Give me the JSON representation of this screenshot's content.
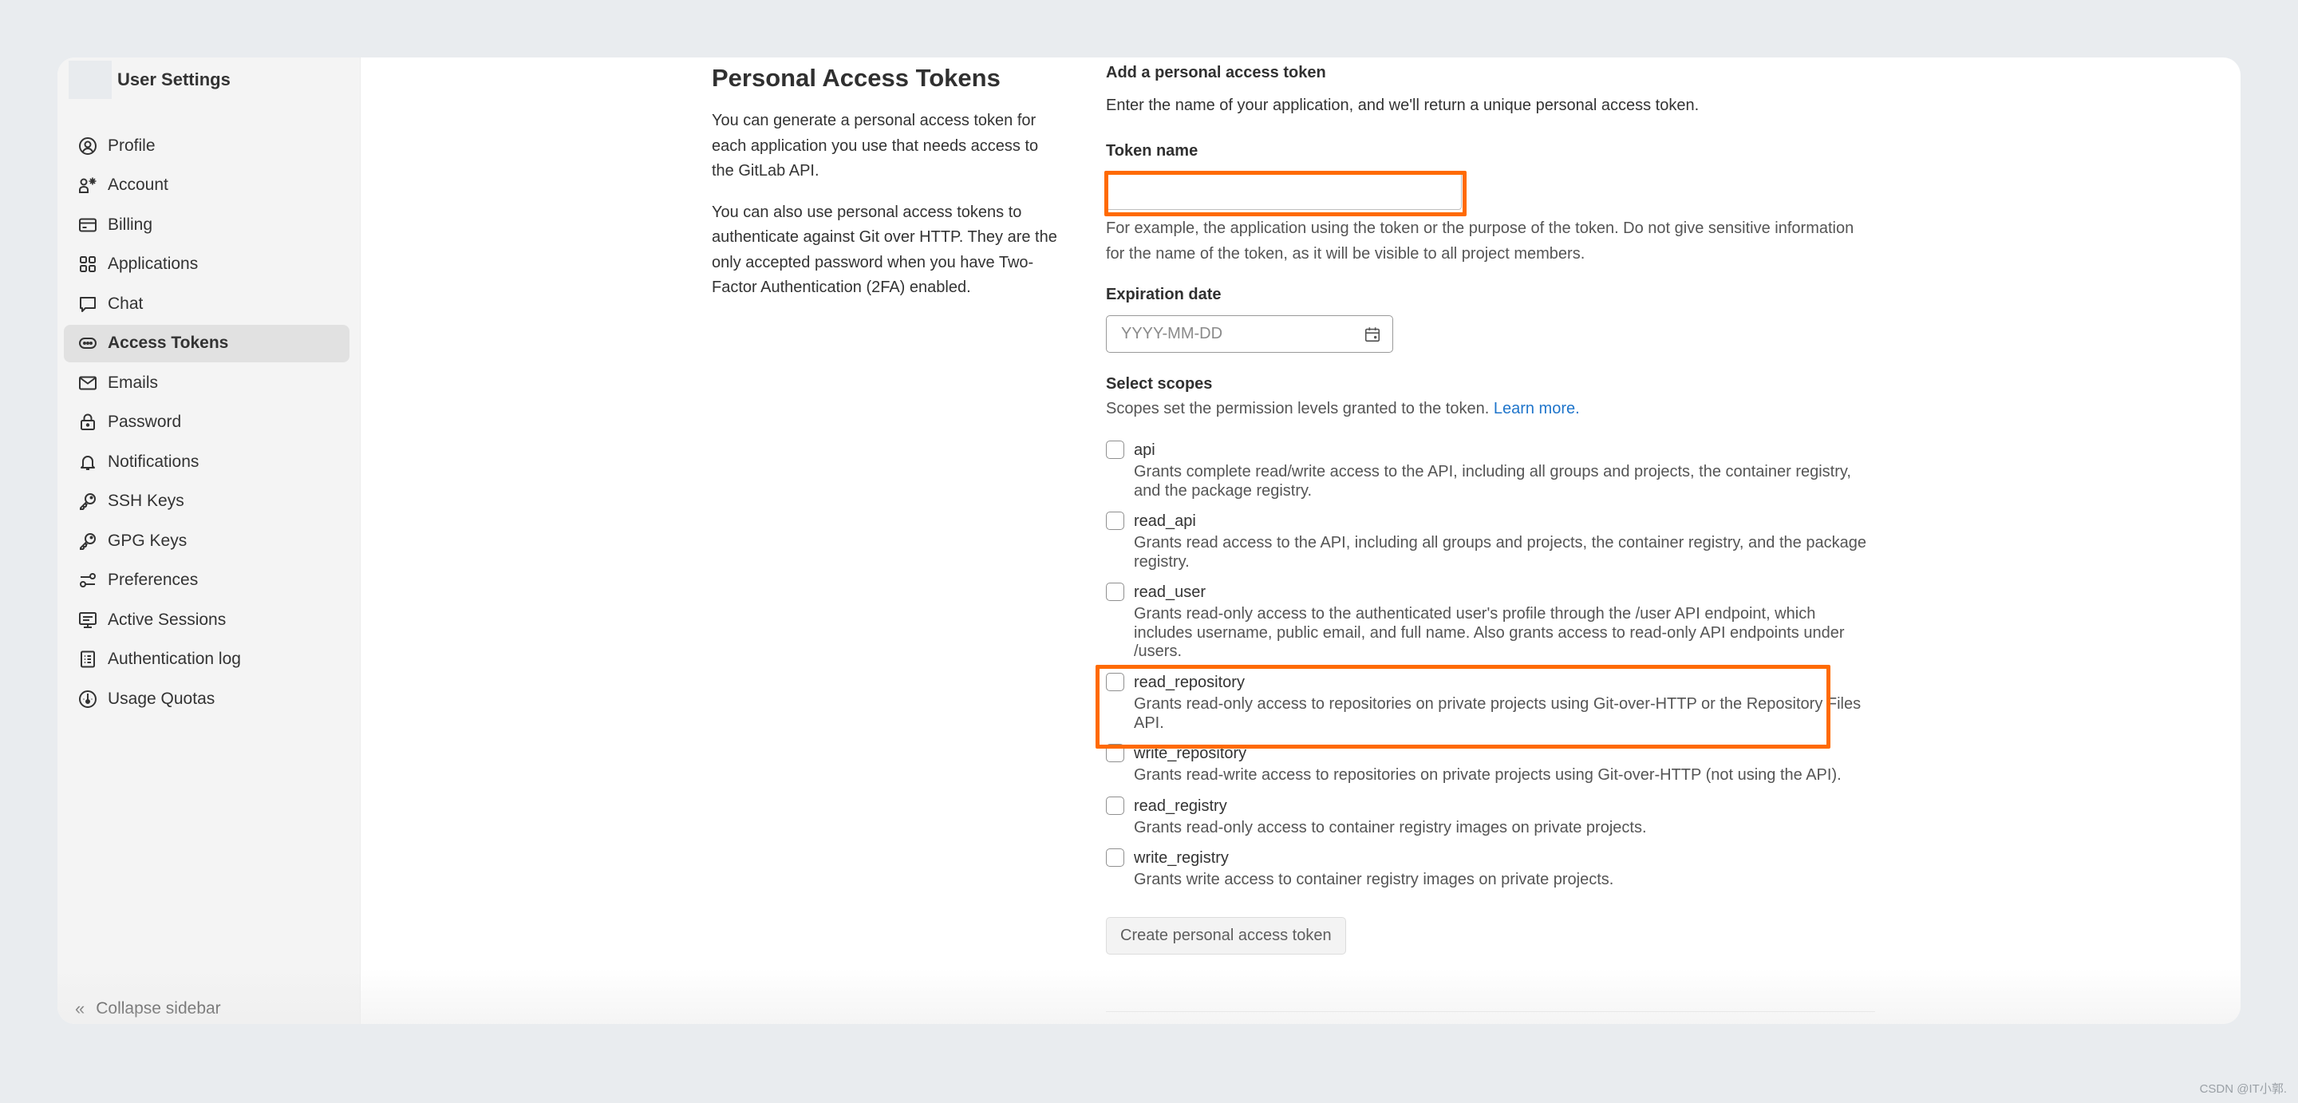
{
  "sidebar": {
    "title": "User Settings",
    "items": [
      {
        "label": "Profile",
        "icon": "profile-icon",
        "active": false
      },
      {
        "label": "Account",
        "icon": "account-icon",
        "active": false
      },
      {
        "label": "Billing",
        "icon": "billing-icon",
        "active": false
      },
      {
        "label": "Applications",
        "icon": "applications-icon",
        "active": false
      },
      {
        "label": "Chat",
        "icon": "chat-icon",
        "active": false
      },
      {
        "label": "Access Tokens",
        "icon": "access-tokens-icon",
        "active": true
      },
      {
        "label": "Emails",
        "icon": "emails-icon",
        "active": false
      },
      {
        "label": "Password",
        "icon": "lock-icon",
        "active": false
      },
      {
        "label": "Notifications",
        "icon": "bell-icon",
        "active": false
      },
      {
        "label": "SSH Keys",
        "icon": "key-icon",
        "active": false
      },
      {
        "label": "GPG Keys",
        "icon": "key-icon",
        "active": false
      },
      {
        "label": "Preferences",
        "icon": "preferences-icon",
        "active": false
      },
      {
        "label": "Active Sessions",
        "icon": "monitor-icon",
        "active": false
      },
      {
        "label": "Authentication log",
        "icon": "log-icon",
        "active": false
      },
      {
        "label": "Usage Quotas",
        "icon": "gauge-icon",
        "active": false
      }
    ],
    "collapse_label": "Collapse sidebar"
  },
  "intro": {
    "title": "Personal Access Tokens",
    "paragraph1": "You can generate a personal access token for each application you use that needs access to the GitLab API.",
    "paragraph2": "You can also use personal access tokens to authenticate against Git over HTTP. They are the only accepted password when you have Two-Factor Authentication (2FA) enabled."
  },
  "form": {
    "title": "Add a personal access token",
    "description": "Enter the name of your application, and we'll return a unique personal access token.",
    "token_name": {
      "label": "Token name",
      "value": "",
      "help": "For example, the application using the token or the purpose of the token. Do not give sensitive information for the name of the token, as it will be visible to all project members."
    },
    "expiration": {
      "label": "Expiration date",
      "placeholder": "YYYY-MM-DD",
      "value": ""
    },
    "scopes": {
      "label": "Select scopes",
      "description": "Scopes set the permission levels granted to the token.",
      "learn_more": "Learn more.",
      "items": [
        {
          "name": "api",
          "checked": false,
          "description": "Grants complete read/write access to the API, including all groups and projects, the container registry, and the package registry."
        },
        {
          "name": "read_api",
          "checked": false,
          "description": "Grants read access to the API, including all groups and projects, the container registry, and the package registry."
        },
        {
          "name": "read_user",
          "checked": false,
          "description": "Grants read-only access to the authenticated user's profile through the /user API endpoint, which includes username, public email, and full name. Also grants access to read-only API endpoints under /users."
        },
        {
          "name": "read_repository",
          "checked": false,
          "description": "Grants read-only access to repositories on private projects using Git-over-HTTP or the Repository Files API."
        },
        {
          "name": "write_repository",
          "checked": false,
          "description": "Grants read-write access to repositories on private projects using Git-over-HTTP (not using the API)."
        },
        {
          "name": "read_registry",
          "checked": false,
          "description": "Grants read-only access to container registry images on private projects."
        },
        {
          "name": "write_registry",
          "checked": false,
          "description": "Grants write access to container registry images on private projects."
        }
      ]
    },
    "submit_label": "Create personal access token"
  },
  "annotation_color": "#ff6a00",
  "watermark": "CSDN @IT小郭."
}
